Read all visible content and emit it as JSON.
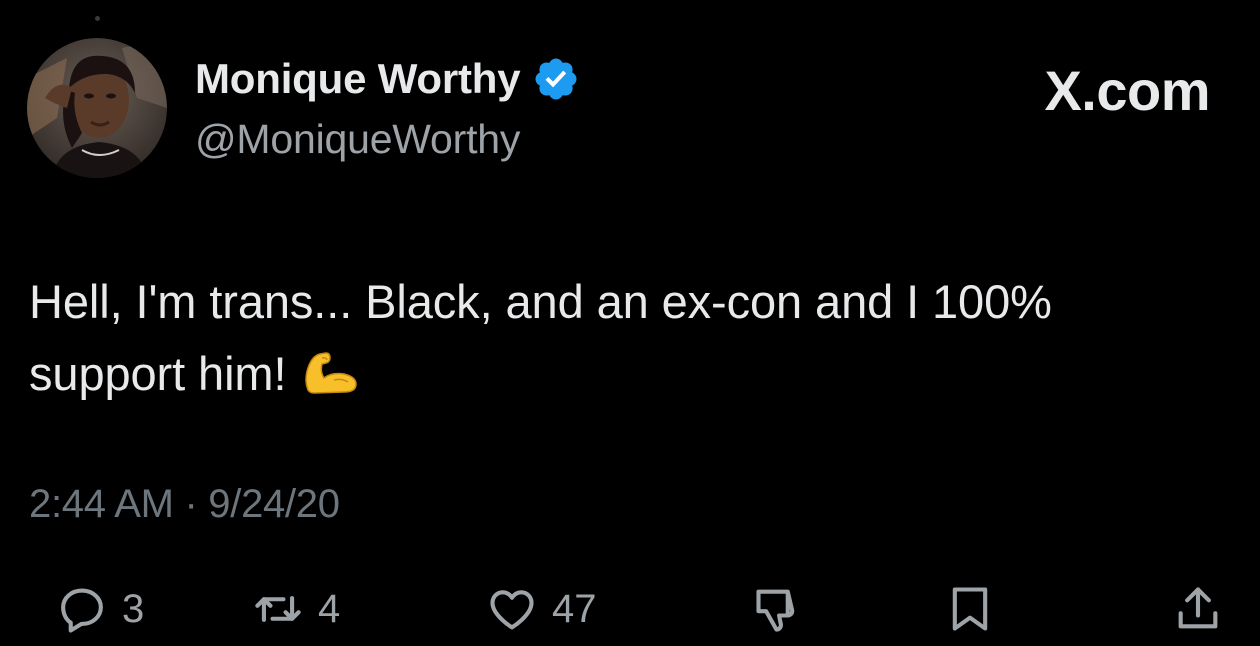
{
  "author": {
    "display_name": "Monique Worthy",
    "handle": "@MoniqueWorthy",
    "verified": true
  },
  "brand": "X.com",
  "tweet": {
    "line1": "Hell, I'm trans... Black, and an ex-con and I 100%",
    "line2": "support him!",
    "emoji": "flexed-biceps"
  },
  "timestamp": "2:44 AM · 9/24/20",
  "actions": {
    "replies": "3",
    "reposts": "4",
    "likes": "47"
  },
  "icons": [
    "reply-icon",
    "repost-icon",
    "like-icon",
    "dislike-icon",
    "bookmark-icon",
    "share-icon",
    "verified-badge-icon"
  ],
  "colors": {
    "background": "#000000",
    "text": "#e7e9ea",
    "secondary_text": "#9ea3a8",
    "timestamp_text": "#6e767d",
    "verified_blue": "#1d9bf0",
    "emoji_yellow": "#f7c02a"
  }
}
